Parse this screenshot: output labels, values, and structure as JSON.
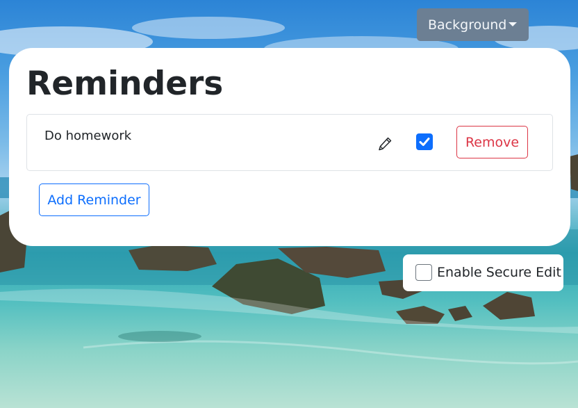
{
  "header": {
    "background_dropdown_label": "Background"
  },
  "main": {
    "title": "Reminders",
    "reminders": [
      {
        "text": "Do homework",
        "done": true,
        "remove_label": "Remove"
      }
    ],
    "add_label": "Add Reminder"
  },
  "secure_edit": {
    "label": "Enable Secure Edit",
    "checked": false
  },
  "icons": {
    "edit": "pencil-icon",
    "caret": "caret-down-icon",
    "check": "check-icon"
  },
  "colors": {
    "primary": "#0d6efd",
    "danger": "#dc3545",
    "secondary": "#6c7f93",
    "text": "#212529",
    "border": "#dee2e6"
  }
}
